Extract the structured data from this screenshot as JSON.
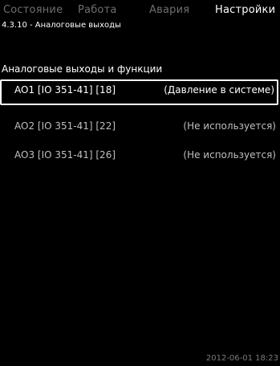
{
  "tabs": [
    {
      "label": "Состояние"
    },
    {
      "label": "Работа"
    },
    {
      "label": "Авария"
    },
    {
      "label": "Настройки"
    }
  ],
  "breadcrumb": "4.3.10 - Аналоговые выходы",
  "section_title": "Аналоговые выходы и функции",
  "outputs": [
    {
      "label": "AO1 [IO 351-41] [18]",
      "value": "(Давление в системе)",
      "selected": true
    },
    {
      "label": "AO2 [IO 351-41] [22]",
      "value": "(Не используется)",
      "selected": false
    },
    {
      "label": "AO3 [IO 351-41] [26]",
      "value": "(Не используется)",
      "selected": false
    }
  ],
  "datetime": "2012-06-01 18:23",
  "colors": {
    "background": "#000000",
    "active_text": "#ffffff",
    "inactive_tab": "#6f6f6f",
    "row_text": "#bfbfbf"
  }
}
